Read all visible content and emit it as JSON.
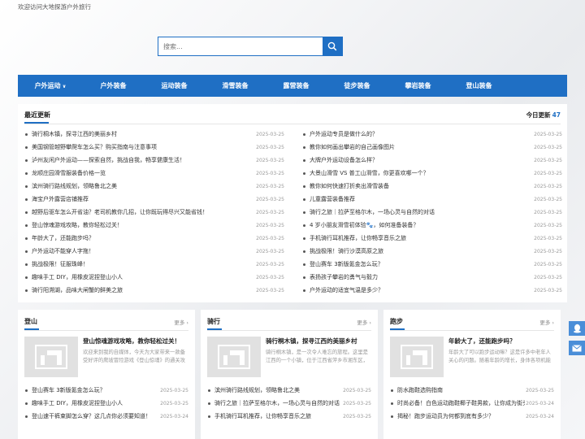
{
  "topbar": {
    "welcome": "欢迎访问大地探游户外旅行"
  },
  "search": {
    "placeholder": "搜索..."
  },
  "nav": [
    "户外运动",
    "户外装备",
    "运动装备",
    "滑雪装备",
    "露营装备",
    "徒步装备",
    "攀岩装备",
    "登山装备"
  ],
  "latest": {
    "title": "最近更新",
    "today_label": "今日更新",
    "today_count": "47",
    "left": [
      {
        "t": "骑行桐木镇，探寻江西的美丽乡村",
        "d": "2025-03-25"
      },
      {
        "t": "美国钢管越野攀爬车怎么买？购买指南与注意事项",
        "d": "2025-03-25"
      },
      {
        "t": "泸州友闲户外运动——探索自然，挑战自我，畅享健康生活！",
        "d": "2025-03-25"
      },
      {
        "t": "龙顺庄园滑雪服装备价格一览",
        "d": "2025-03-25"
      },
      {
        "t": "滨州骑行路线规划，领略鲁北之美",
        "d": "2025-03-25"
      },
      {
        "t": "海宝户外露营店铺推荐",
        "d": "2025-03-25"
      },
      {
        "t": "越野后驱车怎么开省油？老司机教你几招，让你既玩得尽兴又能省钱！",
        "d": "2025-03-25"
      },
      {
        "t": "登山惊魂游戏攻略，教你轻松过关！",
        "d": "2025-03-25"
      },
      {
        "t": "年龄大了，还能跑步吗？",
        "d": "2025-03-25"
      },
      {
        "t": "户外运动不能穿人字拖！",
        "d": "2025-03-25"
      },
      {
        "t": "挑战极限！征服珠峰！",
        "d": "2025-03-25"
      },
      {
        "t": "趣味手工 DIY，用橡皮泥捏登山小人",
        "d": "2025-03-25"
      },
      {
        "t": "骑行阳溯湖，品味大闸蟹的鲜美之旅",
        "d": "2025-03-25"
      }
    ],
    "right": [
      {
        "t": "户外运动专员是做什么的？",
        "d": "2025-03-25"
      },
      {
        "t": "教你如何画出攀岩的自己画像图片",
        "d": "2025-03-25"
      },
      {
        "t": "大牌户外运动设备怎么样？",
        "d": "2025-03-25"
      },
      {
        "t": "大景山滑雪 VS 普工山滑雪，你更喜欢哪一个？",
        "d": "2025-03-25"
      },
      {
        "t": "教你如何快速打折卖出滑雪装备",
        "d": "2025-03-25"
      },
      {
        "t": "儿童露营装备推荐",
        "d": "2025-03-25"
      },
      {
        "t": "骑行之旅｜拉萨至格尔木，一场心灵与自然的对话",
        "d": "2025-03-25"
      },
      {
        "t": "4 岁小朋友滑雪初体验🐾，如何准备装备？",
        "d": "2025-03-25"
      },
      {
        "t": "手机骑行耳机推荐，让你畅享音乐之旅",
        "d": "2025-03-25"
      },
      {
        "t": "挑战极限！骑行沙漠高原之旅",
        "d": "2025-03-25"
      },
      {
        "t": "登山赛车 3新版氪金怎么玩？",
        "d": "2025-03-25"
      },
      {
        "t": "表扬孩子攀岩的勇气与毅力",
        "d": "2025-03-25"
      },
      {
        "t": "户外运动的适宜气温是多少？",
        "d": "2025-03-25"
      }
    ]
  },
  "categories": [
    {
      "name": "登山",
      "more": "更多",
      "feature_title": "登山惊魂游戏攻略，教你轻松过关！",
      "feature_desc": "欢迎来到我的自媒体，今天为大家带来一款备受好评的爬坡冒险游戏《登山惊魂》的通关攻略。",
      "items": [
        {
          "t": "登山赛车 3新版氪金怎么玩？",
          "d": "2025-03-25"
        },
        {
          "t": "趣味手工 DIY，用橡皮泥捏登山小人",
          "d": "2025-03-25"
        },
        {
          "t": "登山速干裤束脚怎么穿？这几点你必须要知道！",
          "d": "2025-03-24"
        }
      ]
    },
    {
      "name": "骑行",
      "more": "更多",
      "feature_title": "骑行桐木镇，探寻江西的美丽乡村",
      "feature_desc": "骑行桐木镇，是一次令人难忘的旅程。这里是江西的一个小镇，位于江西省萍乡市湘东区，是一",
      "items": [
        {
          "t": "滨州骑行路线规划，领略鲁北之美",
          "d": "2025-03-25"
        },
        {
          "t": "骑行之旅｜拉萨至格尔木，一场心灵与自然的对话",
          "d": "2025-03-25"
        },
        {
          "t": "手机骑行耳机推荐，让你畅享音乐之旅",
          "d": "2025-03-25"
        }
      ]
    },
    {
      "name": "跑步",
      "more": "更多",
      "feature_title": "年龄大了，还能跑步吗？",
      "feature_desc": "年龄大了可以跑步运动嘛？这是许多中老年人关心的问题。随着年龄的增长，身体各项机能",
      "items": [
        {
          "t": "防水跑鞋选购指南",
          "d": "2025-03-25"
        },
        {
          "t": "时尚必备！白色运动跑鞋椰子鞋男款，让你成为街头...",
          "d": "2025-03-24"
        },
        {
          "t": "揭秘！跑步运动员为何都到底有多少？",
          "d": "2025-03-24"
        }
      ]
    }
  ],
  "colors": {
    "accent": "#1f6fc4",
    "side_button": "#4a8ed8"
  },
  "icons": {
    "search": "search-icon",
    "thumb": "image-placeholder-icon",
    "side": [
      "qq-icon",
      "mail-icon"
    ]
  }
}
